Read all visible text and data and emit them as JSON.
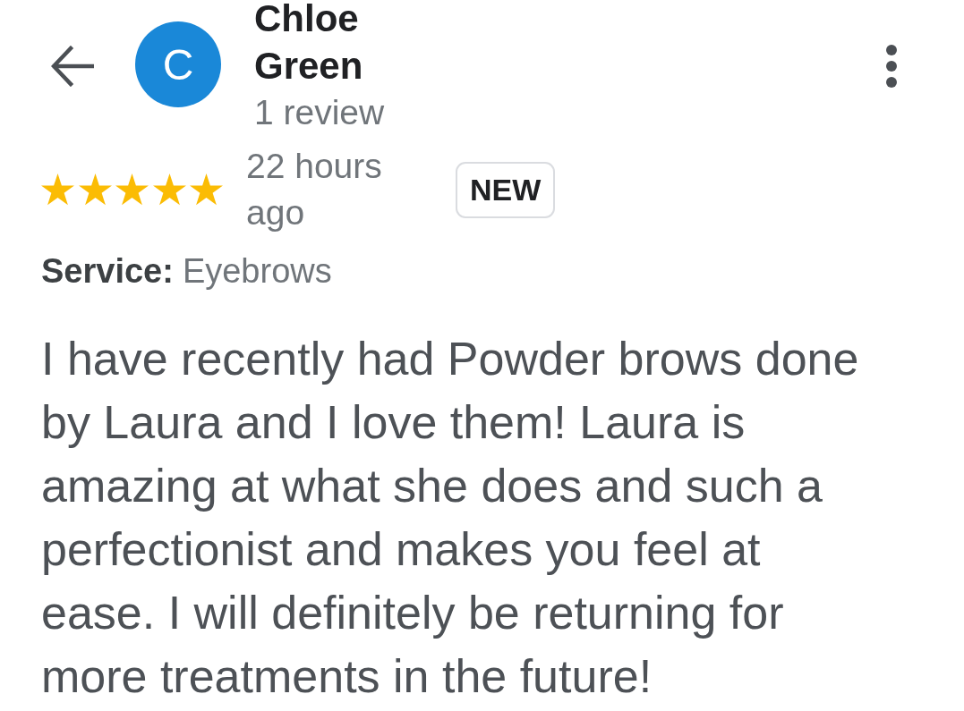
{
  "header": {
    "avatar_initial": "C",
    "reviewer_name": "Chloe Green",
    "review_count": "1 review"
  },
  "review": {
    "stars": 5,
    "time": "22 hours ago",
    "badge": "NEW",
    "service": {
      "label": "Service:",
      "value": "Eyebrows"
    },
    "text": "I have recently had Powder brows done by Laura and I love them! Laura is amazing at what she does and such a perfectionist and makes you feel at ease. I will definitely be returning for more treatments in the future!"
  }
}
